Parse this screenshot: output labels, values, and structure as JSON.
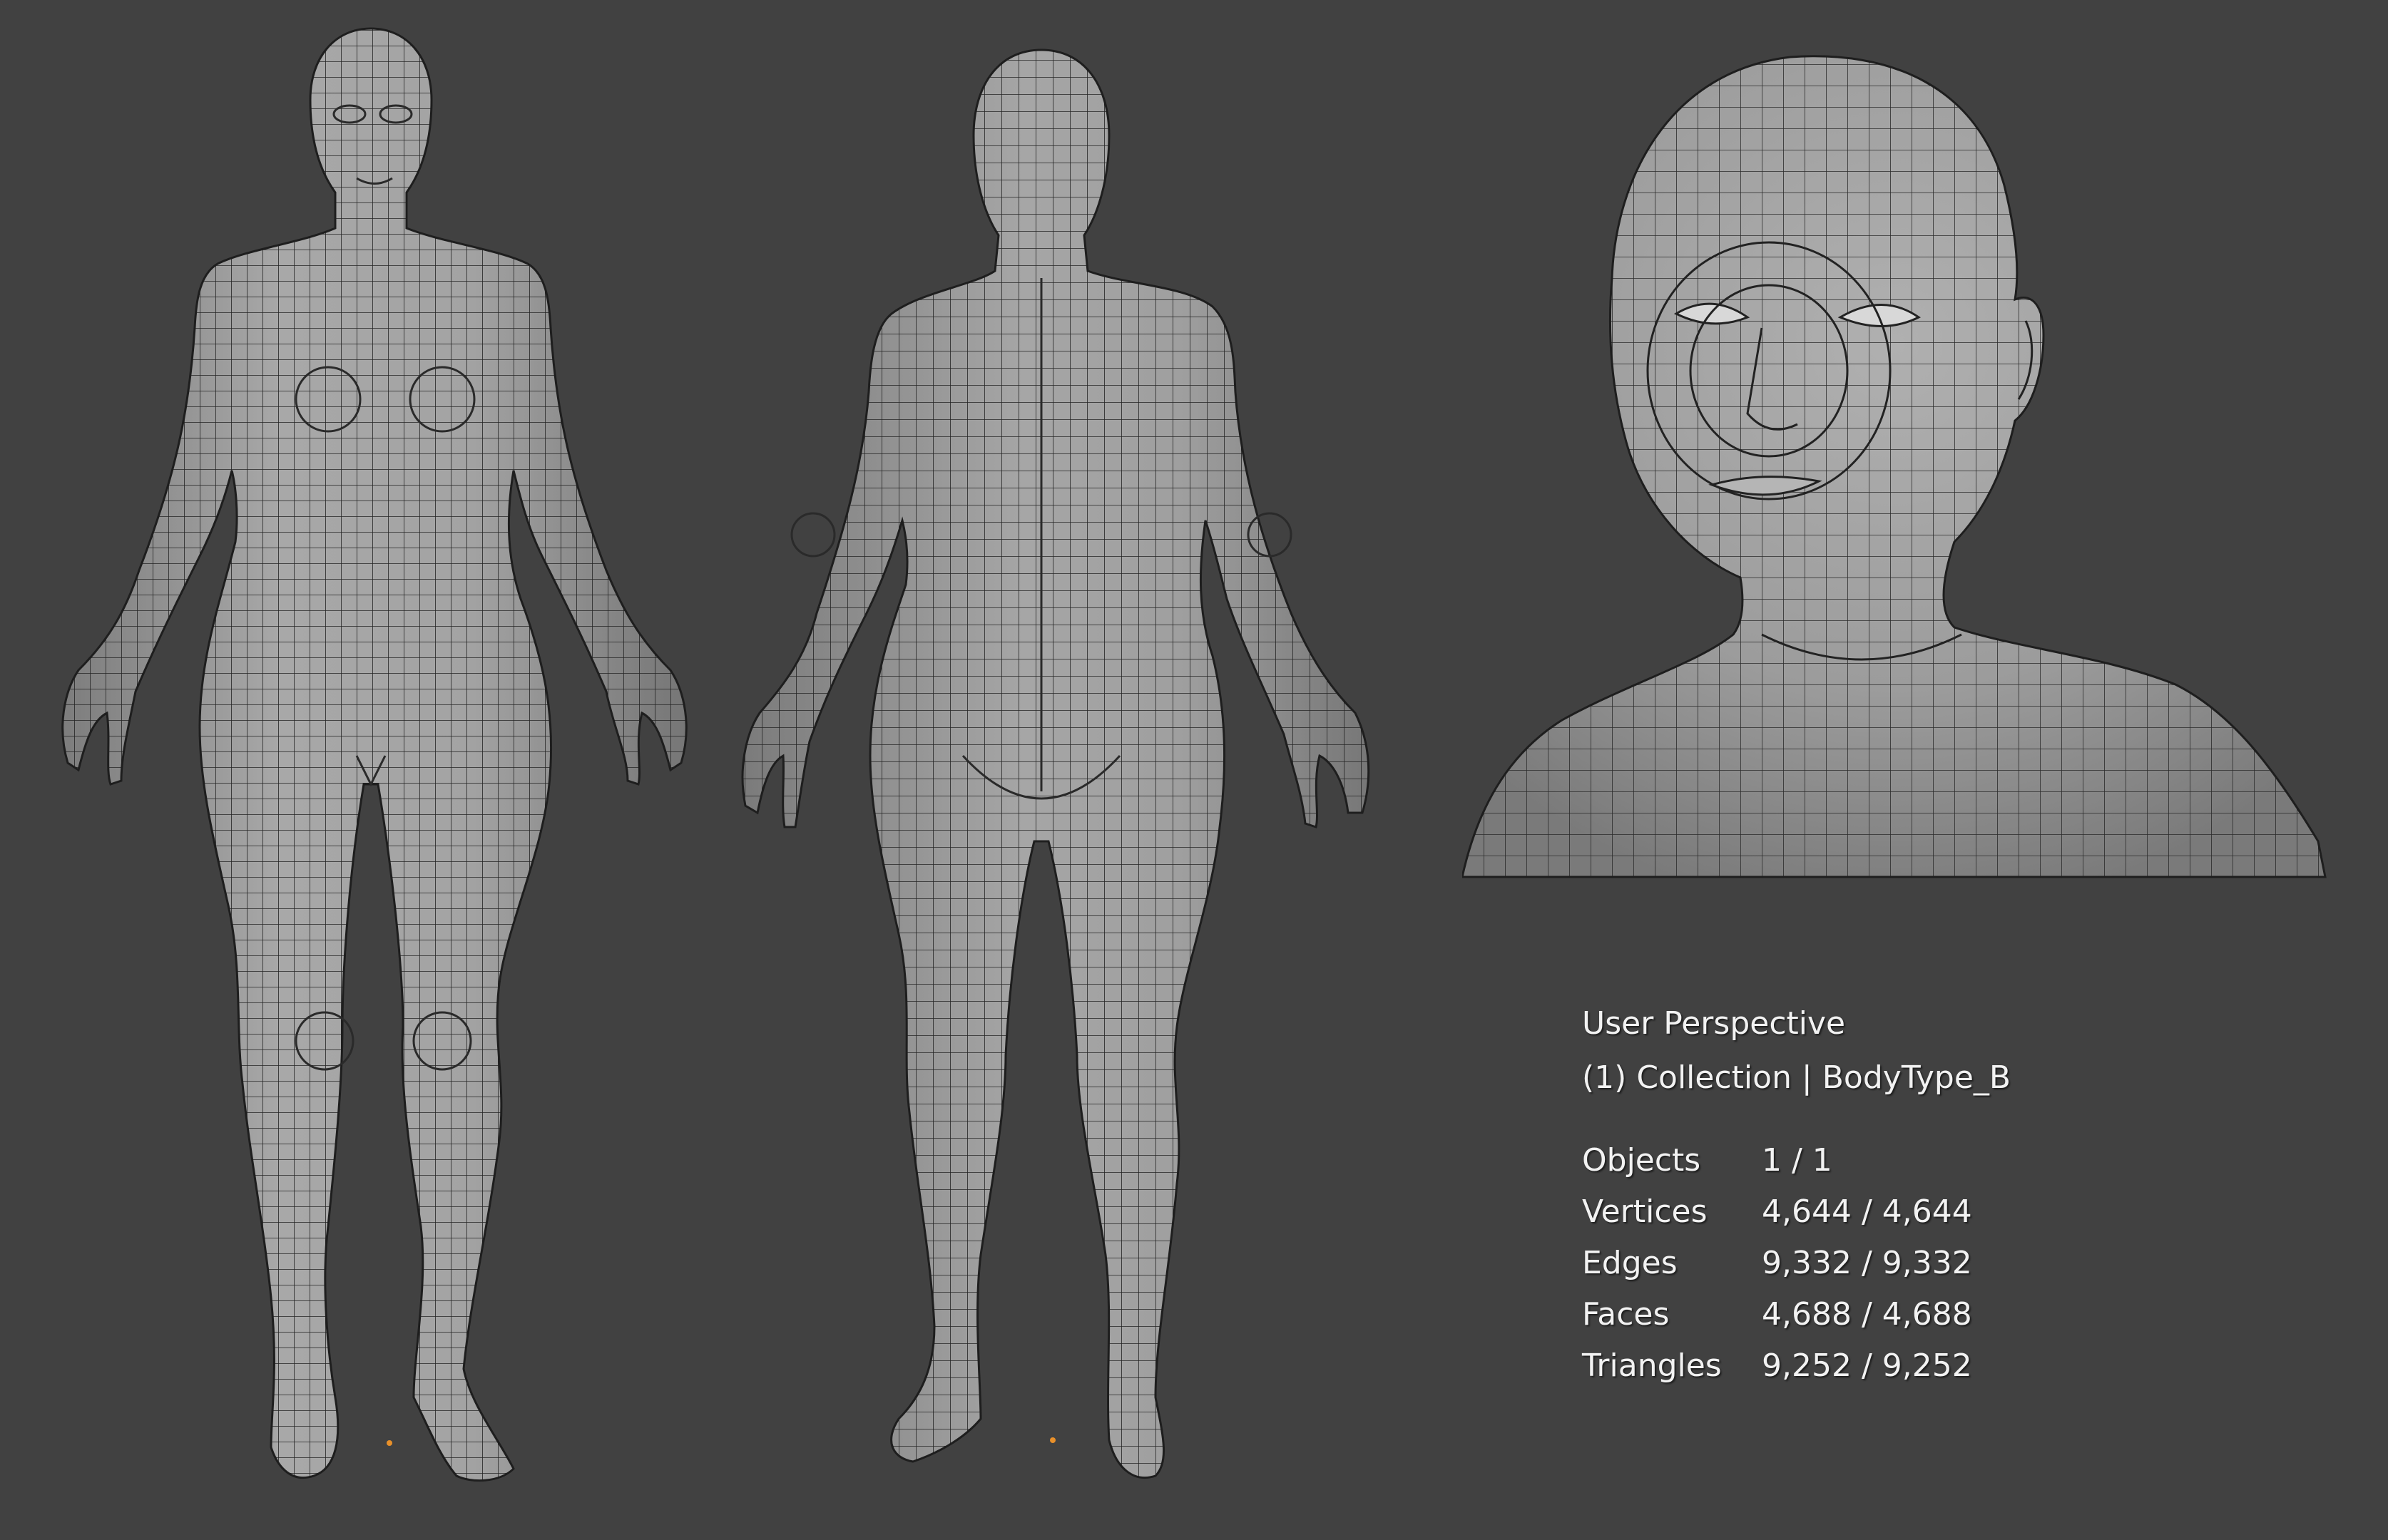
{
  "viewport": {
    "view_name": "User Perspective",
    "collection_line": "(1) Collection | BodyType_B",
    "stats": [
      {
        "label": "Objects",
        "value": "1 / 1"
      },
      {
        "label": "Vertices",
        "value": "4,644 / 4,644"
      },
      {
        "label": "Edges",
        "value": "9,332 / 9,332"
      },
      {
        "label": "Faces",
        "value": "4,688 / 4,688"
      },
      {
        "label": "Triangles",
        "value": "9,252 / 9,252"
      }
    ]
  },
  "colors": {
    "background": "#414141",
    "mesh_fill": "#9a9a9a",
    "wire": "#222222",
    "origin": "#e8902a",
    "overlay_text": "#f2f2f2"
  },
  "icons": [
    "origin-point-icon"
  ]
}
